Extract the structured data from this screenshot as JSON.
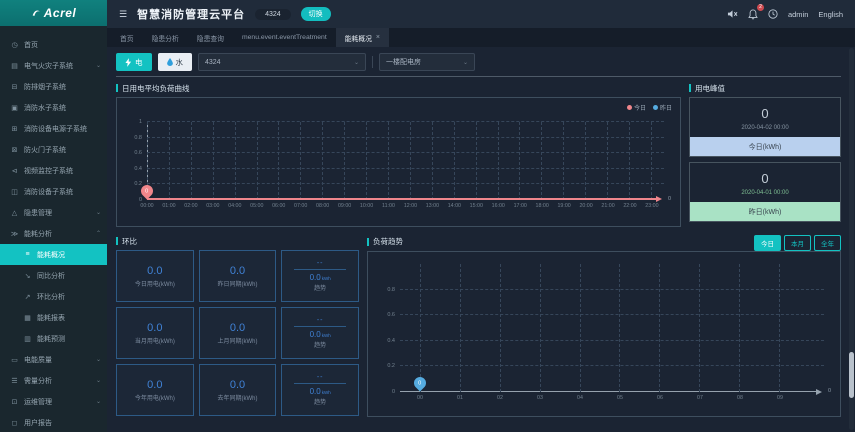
{
  "colors": {
    "teal_accent": "#13c2c2",
    "today_series": "#f0868b",
    "yesterday_series": "#55abe0",
    "stat_value_blue": "#4082d6",
    "today_footer_bg": "#b9d0ee",
    "yesterday_footer_bg": "#a9e2c5",
    "notification_badge_red": "#cf4a50"
  },
  "sidebar": {
    "logo": "Acrel",
    "items": [
      {
        "id": "home",
        "label": "首页",
        "icon": "clock-icon",
        "level": 1
      },
      {
        "id": "electrical-fire",
        "label": "电气火灾子系统",
        "icon": "bar-chart-icon",
        "level": 1,
        "chevron": "down"
      },
      {
        "id": "smoke-extraction",
        "label": "防排烟子系统",
        "icon": "smoke-icon",
        "level": 1
      },
      {
        "id": "fire-water",
        "label": "消防水子系统",
        "icon": "water-system-icon",
        "level": 1
      },
      {
        "id": "fire-equipment-power",
        "label": "消防设备电源子系统",
        "icon": "power-icon",
        "level": 1
      },
      {
        "id": "fire-door",
        "label": "防火门子系统",
        "icon": "door-icon",
        "level": 1
      },
      {
        "id": "video-monitoring",
        "label": "视频监控子系统",
        "icon": "video-icon",
        "level": 1
      },
      {
        "id": "fire-equipment",
        "label": "消防设备子系统",
        "icon": "device-icon",
        "level": 1
      },
      {
        "id": "hazard-management",
        "label": "隐患管理",
        "icon": "warning-icon",
        "level": 1,
        "chevron": "down"
      },
      {
        "id": "energy-analysis",
        "label": "能耗分析",
        "icon": "energy-icon",
        "level": 1,
        "chevron": "up"
      },
      {
        "id": "energy-overview",
        "label": "能耗概况",
        "icon": "list-icon",
        "level": 2,
        "active": true
      },
      {
        "id": "yoy-analysis",
        "label": "同比分析",
        "icon": "trend-down-icon",
        "level": 2
      },
      {
        "id": "mom-analysis",
        "label": "环比分析",
        "icon": "trend-up-icon",
        "level": 2
      },
      {
        "id": "energy-report",
        "label": "能耗报表",
        "icon": "report-icon",
        "level": 2
      },
      {
        "id": "energy-forecast",
        "label": "能耗预测",
        "icon": "forecast-icon",
        "level": 2
      },
      {
        "id": "power-quality",
        "label": "电能质量",
        "icon": "quality-icon",
        "level": 1,
        "chevron": "down"
      },
      {
        "id": "demand-analysis",
        "label": "需量分析",
        "icon": "demand-icon",
        "level": 1,
        "chevron": "down"
      },
      {
        "id": "operations-management",
        "label": "运维管理",
        "icon": "ops-icon",
        "level": 1,
        "chevron": "down"
      },
      {
        "id": "user-report",
        "label": "用户报告",
        "icon": "user-icon",
        "level": 1
      }
    ]
  },
  "header": {
    "title": "智慧消防管理云平台",
    "station_badge": "4324",
    "switch_button": "切换",
    "notification_count": "2",
    "username": "admin",
    "language": "English"
  },
  "tabs": [
    {
      "id": "home",
      "label": "首页"
    },
    {
      "id": "hazard-analysis",
      "label": "隐患分析"
    },
    {
      "id": "hazard-query",
      "label": "隐患查询"
    },
    {
      "id": "event-treatment",
      "label": "menu.event.eventTreatment"
    },
    {
      "id": "energy-overview",
      "label": "能耗概况",
      "active": true,
      "closable": true
    }
  ],
  "filters": {
    "electric_label": "电",
    "water_label": "水",
    "station_select": "4324",
    "room_select": "一楼配电房"
  },
  "load_curve": {
    "title": "日用电平均负荷曲线",
    "marker_value": "0",
    "axis_end_label": "0"
  },
  "peak": {
    "title": "用电峰值",
    "cards": [
      {
        "value": "0",
        "datetime": "2020-04-02 00:00",
        "label": "今日(kWh)"
      },
      {
        "value": "0",
        "datetime": "2020-04-01 00:00",
        "label": "昨日(kWh)"
      }
    ]
  },
  "ring": {
    "title": "环比",
    "rows": [
      {
        "cells": [
          {
            "value": "0.0",
            "label": "今日用电(kWh)"
          },
          {
            "value": "0.0",
            "label": "昨日同期(kWh)"
          },
          {
            "type": "trend",
            "top": "--",
            "value": "0.0",
            "unit": "kWh",
            "label": "趋势"
          }
        ]
      },
      {
        "cells": [
          {
            "value": "0.0",
            "label": "当月用电(kWh)"
          },
          {
            "value": "0.0",
            "label": "上月同期(kWh)"
          },
          {
            "type": "trend",
            "top": "--",
            "value": "0.0",
            "unit": "kWh",
            "label": "趋势"
          }
        ]
      },
      {
        "cells": [
          {
            "value": "0.0",
            "label": "今年用电(kWh)"
          },
          {
            "value": "0.0",
            "label": "去年同期(kWh)"
          },
          {
            "type": "trend",
            "top": "--",
            "value": "0.0",
            "unit": "kWh",
            "label": "趋势"
          }
        ]
      }
    ]
  },
  "load_trend": {
    "title": "负荷趋势",
    "buttons": [
      {
        "id": "today",
        "label": "今日",
        "active": true
      },
      {
        "id": "month",
        "label": "本月"
      },
      {
        "id": "year",
        "label": "全年"
      }
    ],
    "marker_value": "0",
    "axis_end_label": "0"
  },
  "chart_data": [
    {
      "type": "line",
      "title": "日用电平均负荷曲线",
      "x": [
        "00:00",
        "01:00",
        "02:00",
        "03:00",
        "04:00",
        "05:00",
        "06:00",
        "07:00",
        "08:00",
        "09:00",
        "10:00",
        "11:00",
        "12:00",
        "13:00",
        "14:00",
        "15:00",
        "16:00",
        "17:00",
        "18:00",
        "19:00",
        "20:00",
        "21:00",
        "22:00",
        "23:00"
      ],
      "series": [
        {
          "name": "今日",
          "color": "#f0868b",
          "values": [
            0
          ]
        },
        {
          "name": "昨日",
          "color": "#55abe0",
          "values": []
        }
      ],
      "marker": {
        "x": "00:00",
        "value": 0,
        "series": "今日"
      },
      "ylim": [
        0,
        1
      ],
      "yticks": [
        0,
        0.2,
        0.4,
        0.6,
        0.8,
        1
      ],
      "legend_position": "top-right",
      "grid": "dashed"
    },
    {
      "type": "line",
      "title": "负荷趋势",
      "x": [
        "00",
        "01",
        "02",
        "03",
        "04",
        "05",
        "06",
        "07",
        "08",
        "09"
      ],
      "series": [
        {
          "name": "今日",
          "color": "#55abe0",
          "values": [
            0
          ]
        }
      ],
      "marker": {
        "x": "00",
        "value": 0,
        "series": "今日"
      },
      "ylim": [
        0,
        1
      ],
      "yticks": [
        0,
        0.2,
        0.4,
        0.6,
        0.8
      ],
      "legend_position": "none",
      "grid": "dashed"
    }
  ]
}
